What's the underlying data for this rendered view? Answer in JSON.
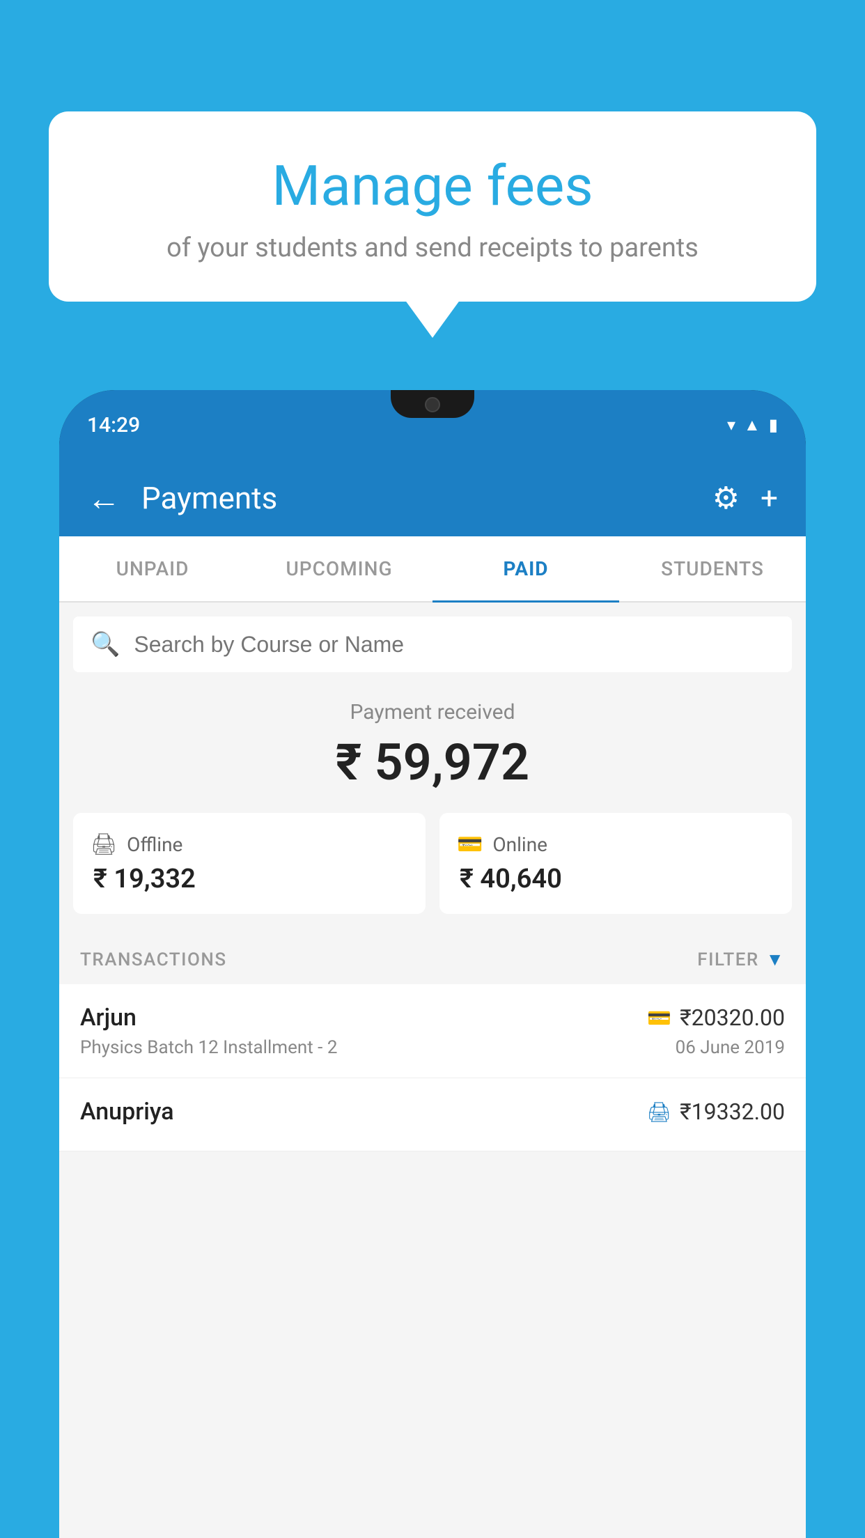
{
  "background_color": "#29abe2",
  "speech_bubble": {
    "heading": "Manage fees",
    "subtext": "of your students and send receipts to parents"
  },
  "phone": {
    "status_bar": {
      "time": "14:29",
      "icons": [
        "wifi",
        "signal",
        "battery"
      ]
    },
    "app_bar": {
      "title": "Payments",
      "back_label": "←",
      "settings_label": "⚙",
      "add_label": "+"
    },
    "tabs": [
      {
        "id": "unpaid",
        "label": "UNPAID",
        "active": false
      },
      {
        "id": "upcoming",
        "label": "UPCOMING",
        "active": false
      },
      {
        "id": "paid",
        "label": "PAID",
        "active": true
      },
      {
        "id": "students",
        "label": "STUDENTS",
        "active": false
      }
    ],
    "search": {
      "placeholder": "Search by Course or Name"
    },
    "payment_summary": {
      "label": "Payment received",
      "amount": "₹ 59,972",
      "offline_label": "Offline",
      "offline_amount": "₹ 19,332",
      "online_label": "Online",
      "online_amount": "₹ 40,640"
    },
    "transactions": {
      "section_label": "TRANSACTIONS",
      "filter_label": "FILTER",
      "rows": [
        {
          "name": "Arjun",
          "pay_type": "online",
          "amount": "₹20320.00",
          "course": "Physics Batch 12 Installment - 2",
          "date": "06 June 2019"
        },
        {
          "name": "Anupriya",
          "pay_type": "offline",
          "amount": "₹19332.00",
          "course": "",
          "date": ""
        }
      ]
    }
  }
}
